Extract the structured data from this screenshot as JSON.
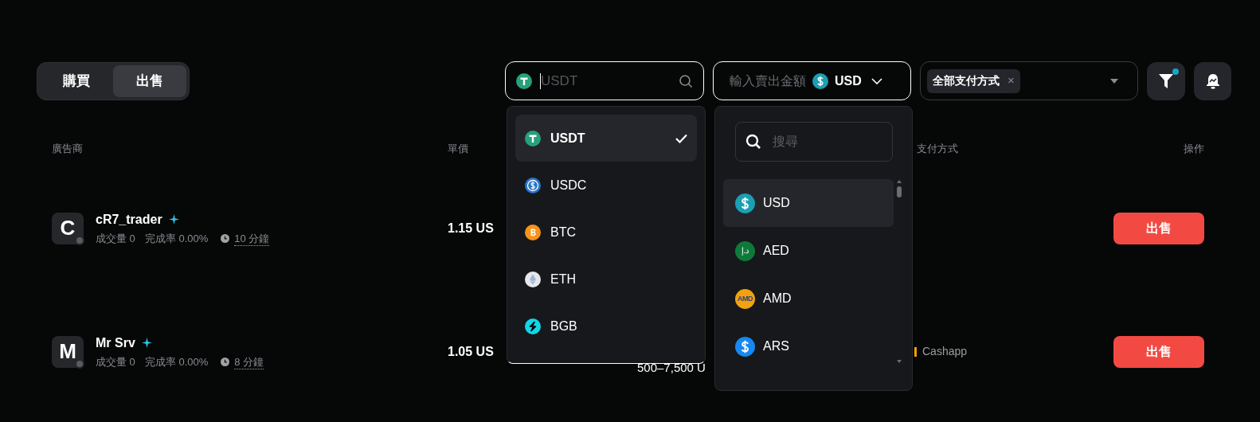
{
  "trade_tabs": [
    {
      "label": "購買",
      "selected": false
    },
    {
      "label": "出售",
      "selected": true
    }
  ],
  "crypto_field": {
    "placeholder": "USDT"
  },
  "amount_field": {
    "placeholder": "輸入賣出金額",
    "currency": "USD"
  },
  "payment_filter": {
    "chip": "全部支付方式",
    "chip_close": "×"
  },
  "filter_button": {
    "badge": true
  },
  "table": {
    "columns": [
      "廣告商",
      "單價",
      "支付方式",
      "操作"
    ],
    "rows": [
      {
        "avatar": "C",
        "name": "cR7_trader",
        "verified": true,
        "volume": "成交量 0",
        "completion": "完成率 0.00%",
        "time": "10 分鐘",
        "price": "1.15 US",
        "action": "出售"
      },
      {
        "avatar": "M",
        "name": "Mr Srv",
        "verified": true,
        "volume": "成交量 0",
        "completion": "完成率 0.00%",
        "time": "8 分鐘",
        "price": "1.05 US",
        "limit": "500–7,500 U",
        "payment": {
          "name": "Cashapp",
          "color": "#f5a000"
        },
        "action": "出售"
      }
    ]
  },
  "crypto_menu": {
    "items": [
      {
        "symbol": "USDT",
        "kind": "tether",
        "color": "#26a17b",
        "selected": true
      },
      {
        "symbol": "USDC",
        "kind": "usdc",
        "color": "#2775ca",
        "selected": false
      },
      {
        "symbol": "BTC",
        "kind": "btc",
        "color": "#f7931a",
        "selected": false
      },
      {
        "symbol": "ETH",
        "kind": "eth",
        "color": "#e6e8ec",
        "selected": false
      },
      {
        "symbol": "BGB",
        "kind": "bgb",
        "color": "#12d6e8",
        "selected": false
      }
    ]
  },
  "fiat_menu": {
    "search_placeholder": "搜尋",
    "items": [
      {
        "code": "USD",
        "kind": "dollar",
        "color": "#1a9fb3",
        "selected": true
      },
      {
        "code": "AED",
        "kind": "text",
        "icon_text": "د.إ",
        "color": "#0e7a3a",
        "selected": false
      },
      {
        "code": "AMD",
        "kind": "text",
        "icon_text": "AMD",
        "color": "#f2a20c",
        "selected": false
      },
      {
        "code": "ARS",
        "kind": "dollar",
        "color": "#1688f2",
        "selected": false
      }
    ]
  }
}
